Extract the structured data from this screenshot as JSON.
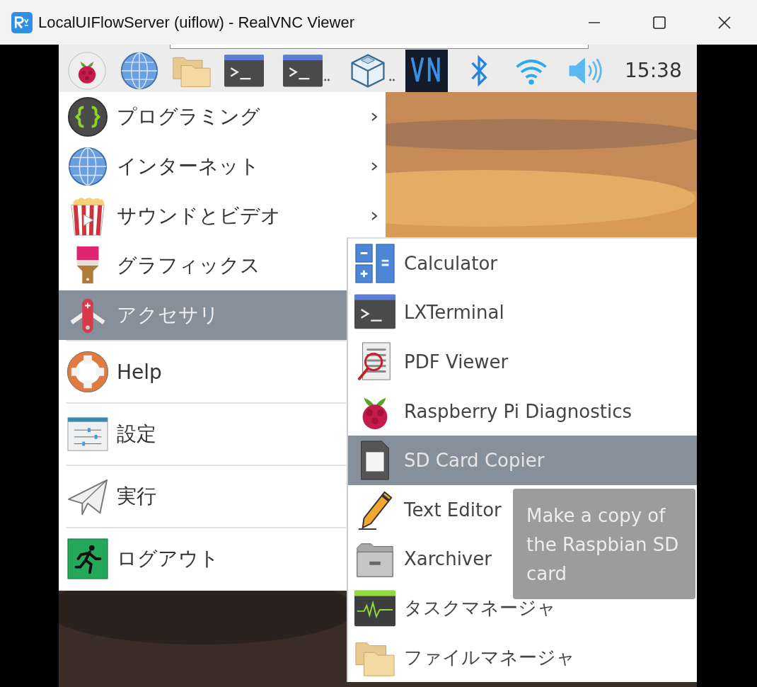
{
  "window": {
    "title": "LocalUIFlowServer (uiflow) - RealVNC Viewer"
  },
  "taskbar": {
    "clock": "15:38"
  },
  "menu": {
    "groups": [
      [
        {
          "label": "プログラミング",
          "submenu": true,
          "selected": false
        },
        {
          "label": "インターネット",
          "submenu": true,
          "selected": false
        },
        {
          "label": "サウンドとビデオ",
          "submenu": true,
          "selected": false
        },
        {
          "label": "グラフィックス",
          "submenu": false,
          "selected": false
        },
        {
          "label": "アクセサリ",
          "submenu": false,
          "selected": true
        }
      ],
      [
        {
          "label": "Help",
          "submenu": false,
          "selected": false
        }
      ],
      [
        {
          "label": "設定",
          "submenu": false,
          "selected": false
        }
      ],
      [
        {
          "label": "実行",
          "submenu": false,
          "selected": false
        }
      ],
      [
        {
          "label": "ログアウト",
          "submenu": false,
          "selected": false
        }
      ]
    ]
  },
  "submenu": {
    "items": [
      {
        "label": "Calculator",
        "selected": false
      },
      {
        "label": "LXTerminal",
        "selected": false
      },
      {
        "label": "PDF Viewer",
        "selected": false
      },
      {
        "label": "Raspberry Pi Diagnostics",
        "selected": false
      },
      {
        "label": "SD Card Copier",
        "selected": true
      },
      {
        "label": "Text Editor",
        "selected": false
      },
      {
        "label": "Xarchiver",
        "selected": false
      },
      {
        "label": "タスクマネージャ",
        "selected": false
      },
      {
        "label": "ファイルマネージャ",
        "selected": false
      }
    ]
  },
  "tooltip": {
    "text": "Make a copy of the Raspbian SD card"
  }
}
